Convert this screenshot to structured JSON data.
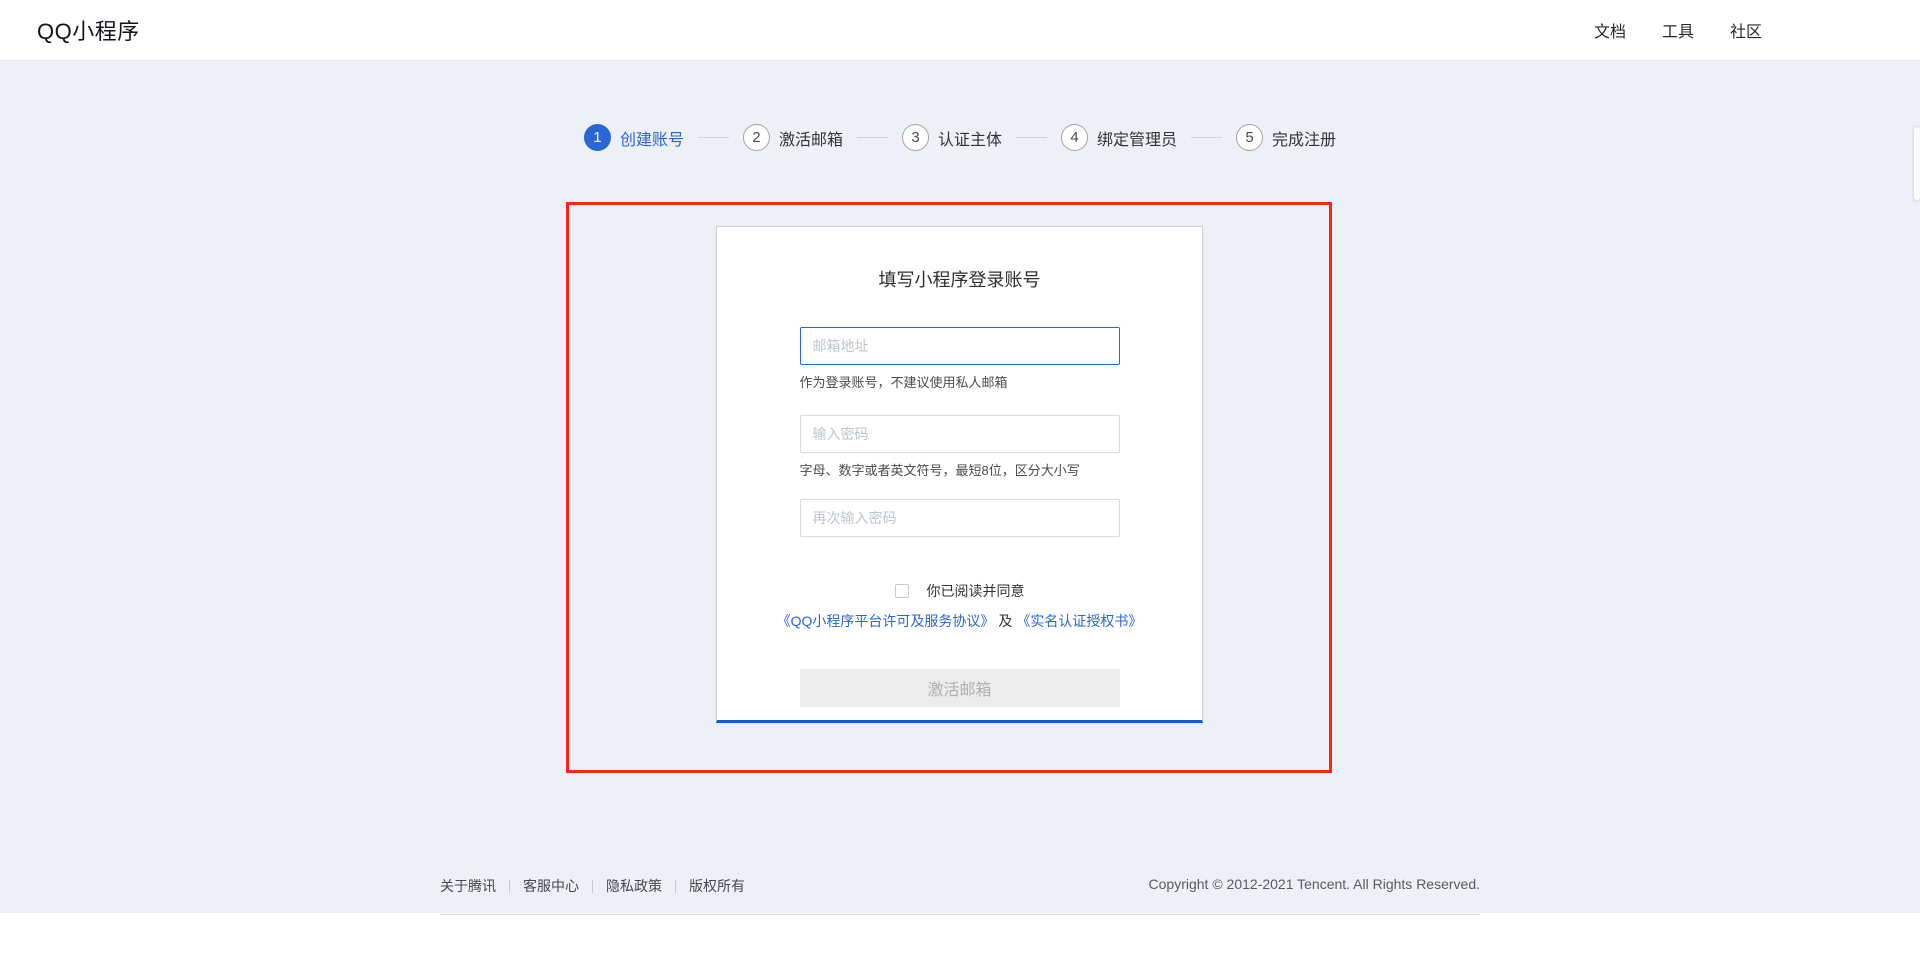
{
  "header": {
    "logo": "QQ小程序",
    "nav": [
      {
        "label": "文档"
      },
      {
        "label": "工具"
      },
      {
        "label": "社区"
      }
    ]
  },
  "stepper": {
    "steps": [
      {
        "number": "1",
        "label": "创建账号",
        "active": true
      },
      {
        "number": "2",
        "label": "激活邮箱",
        "active": false
      },
      {
        "number": "3",
        "label": "认证主体",
        "active": false
      },
      {
        "number": "4",
        "label": "绑定管理员",
        "active": false
      },
      {
        "number": "5",
        "label": "完成注册",
        "active": false
      }
    ]
  },
  "form": {
    "title": "填写小程序登录账号",
    "email": {
      "value": "",
      "placeholder": "邮箱地址",
      "hint": "作为登录账号，不建议使用私人邮箱"
    },
    "password": {
      "value": "",
      "placeholder": "输入密码",
      "hint": "字母、数字或者英文符号，最短8位，区分大小写"
    },
    "password_confirm": {
      "value": "",
      "placeholder": "再次输入密码"
    },
    "agreement": {
      "checkbox_checked": false,
      "label": "你已阅读并同意",
      "link1": "《QQ小程序平台许可及服务协议》",
      "conjunction": "及",
      "link2": "《实名认证授权书》"
    },
    "submit_label": "激活邮箱",
    "submit_enabled": false
  },
  "footer": {
    "links": [
      {
        "label": "关于腾讯"
      },
      {
        "label": "客服中心"
      },
      {
        "label": "隐私政策"
      },
      {
        "label": "版权所有"
      }
    ],
    "copyright": "Copyright © 2012-2021 Tencent. All Rights Reserved."
  },
  "colors": {
    "accent_blue": "#2a66d4",
    "card_bottom_blue": "#0d5cd8",
    "annotation_red": "#fe2418",
    "page_background": "#eef0f7"
  }
}
